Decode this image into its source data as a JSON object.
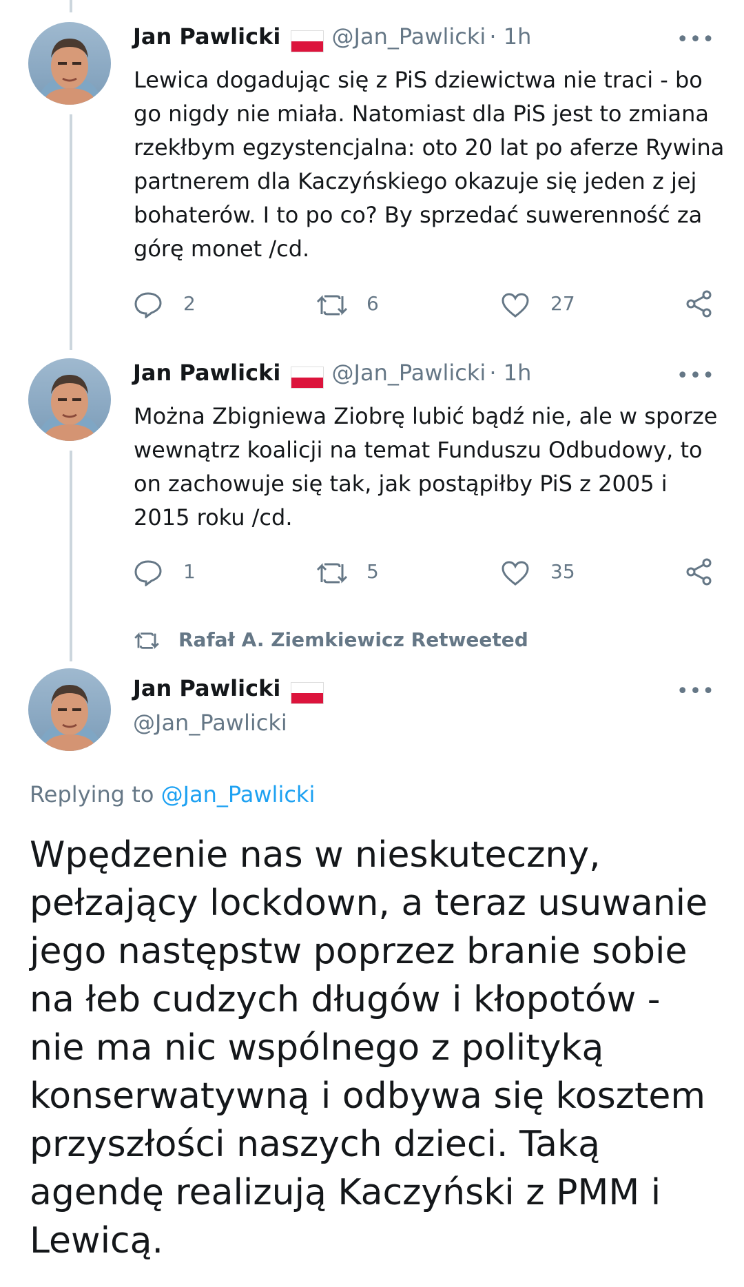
{
  "tweets": [
    {
      "author": "Jan Pawlicki",
      "handle": "@Jan_Pawlicki",
      "time": "· 1h",
      "text": "Lewica dogadując się z PiS dziewictwa nie traci - bo go nigdy nie miała. Natomiast dla PiS jest to zmiana rzekłbym egzystencjalna: oto 20 lat po aferze Rywina partnerem dla Kaczyńskiego okazuje się jeden z jej bohaterów. I to po co? By sprzedać suwerenność za górę monet /cd.",
      "replies": "2",
      "retweets": "6",
      "likes": "27"
    },
    {
      "author": "Jan Pawlicki",
      "handle": "@Jan_Pawlicki",
      "time": "· 1h",
      "text": "Można Zbigniewa Ziobrę lubić bądź nie, ale w sporze wewnątrz koalicji na temat Funduszu Odbudowy, to on zachowuje się tak, jak postąpiłby PiS z 2005 i 2015 roku /cd.",
      "replies": "1",
      "retweets": "5",
      "likes": "35"
    }
  ],
  "retweet_label": "Rafał A. Ziemkiewicz Retweeted",
  "main_tweet": {
    "author": "Jan Pawlicki",
    "handle": "@Jan_Pawlicki",
    "replying_prefix": "Replying to",
    "replying_handle": "@Jan_Pawlicki",
    "text": "Wpędzenie nas w nieskuteczny, pełzający lockdown, a teraz usuwanie jego następstw poprzez branie sobie na łeb cudzych długów i kłopotów - nie ma nic wspólnego z polityką konserwatywną i odbywa się kosztem przyszłości naszych dzieci. Taką agendę realizują Kaczyński z PMM i Lewicą."
  },
  "more_label": "•••",
  "colors": {
    "text": "#14171a",
    "secondary": "#657786",
    "link": "#1da1f2",
    "flag_red": "#dc143c"
  },
  "icons": [
    "reply-icon",
    "retweet-icon",
    "like-icon",
    "share-icon",
    "more-icon",
    "flag-icon"
  ]
}
